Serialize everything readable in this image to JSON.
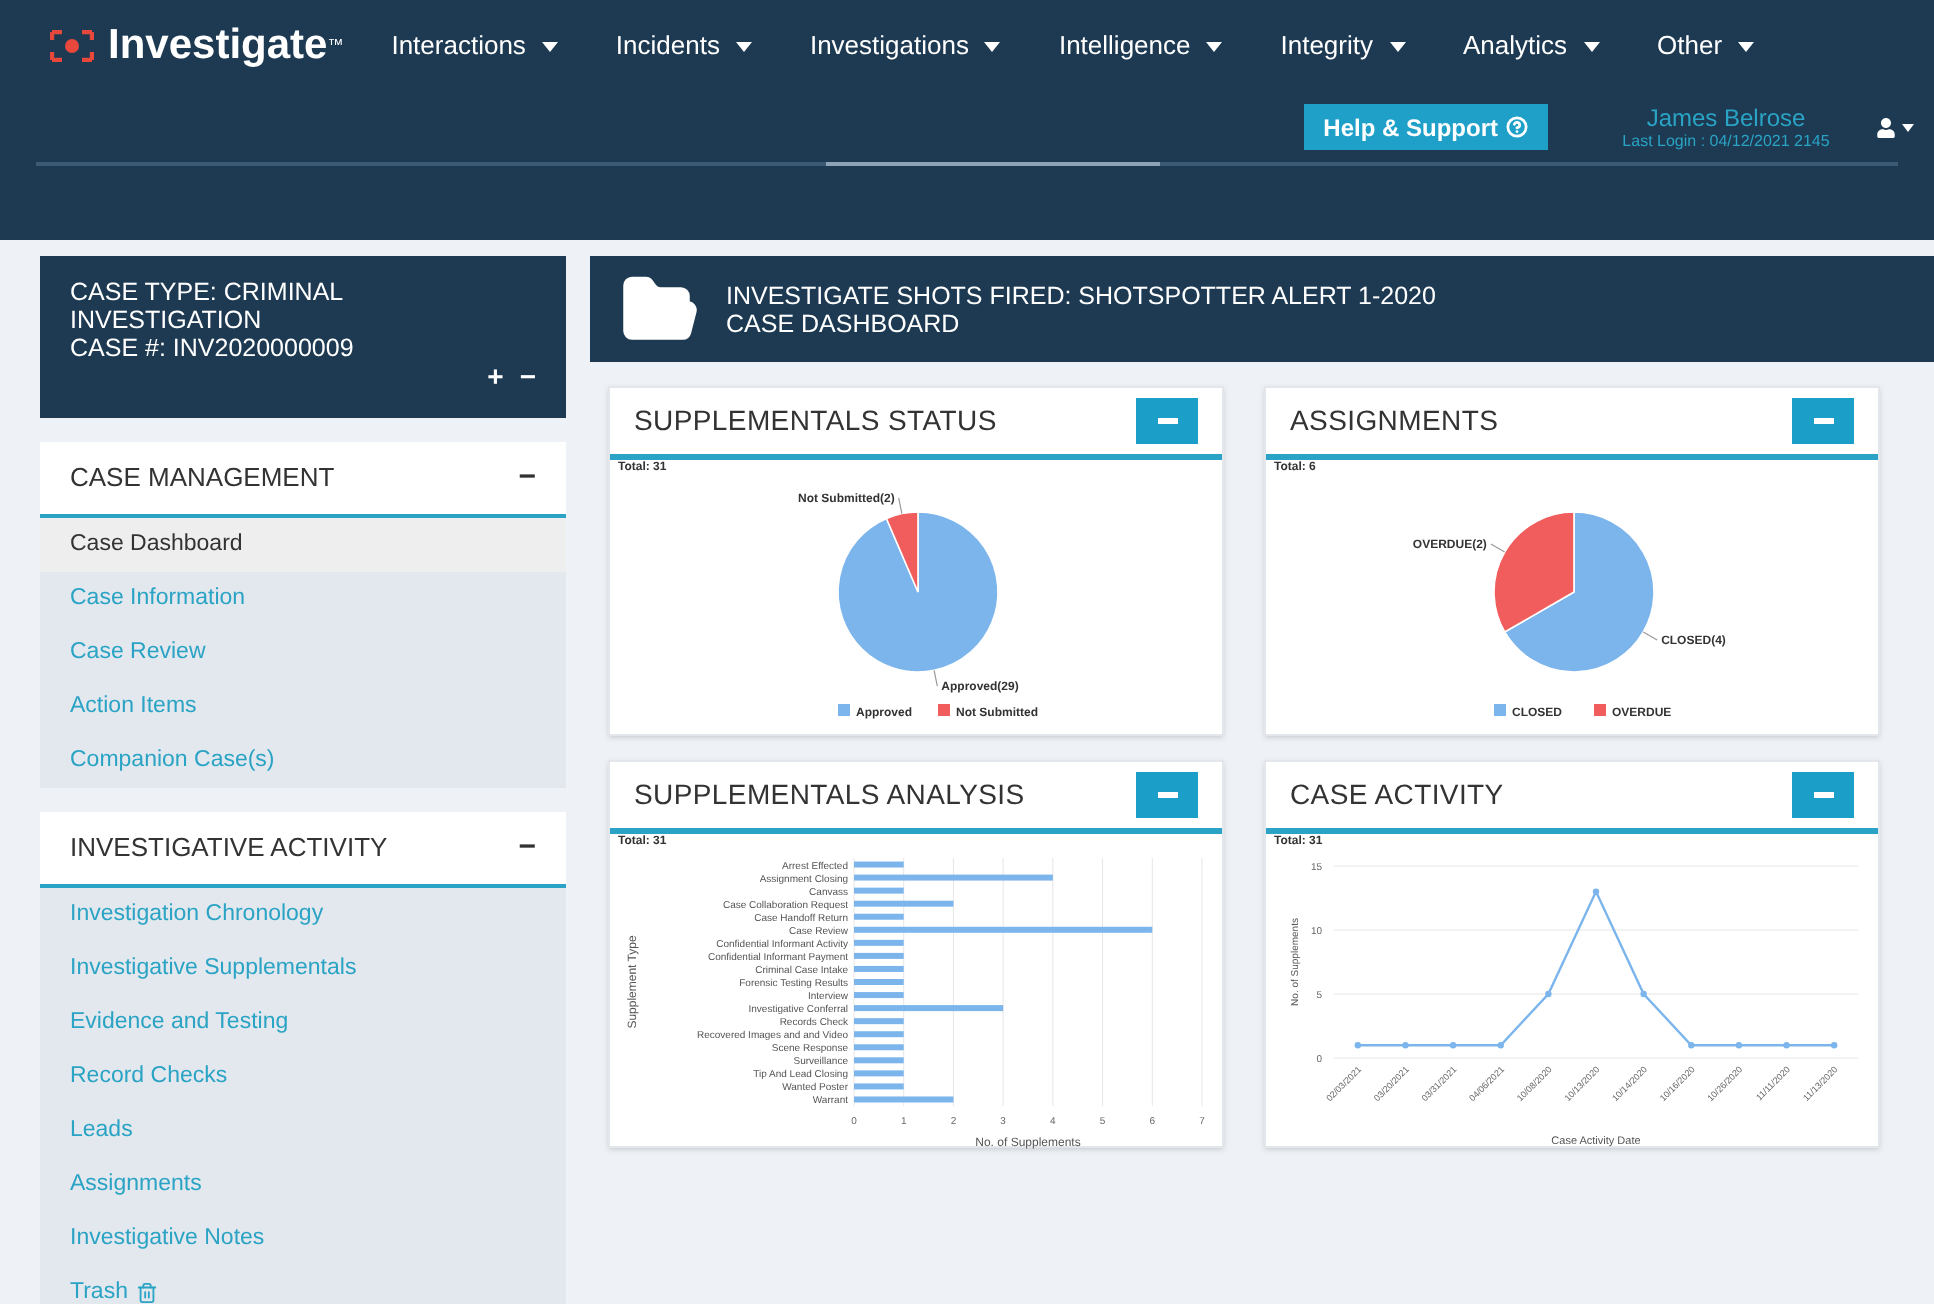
{
  "header": {
    "logo": "Investigate",
    "trademark": "™",
    "nav": [
      {
        "label": "Interactions"
      },
      {
        "label": "Incidents"
      },
      {
        "label": "Investigations"
      },
      {
        "label": "Intelligence"
      },
      {
        "label": "Integrity"
      },
      {
        "label": "Analytics"
      },
      {
        "label": "Other"
      }
    ],
    "help_button": "Help & Support",
    "user": {
      "name": "James Belrose",
      "last_login": "Last Login : 04/12/2021 2145"
    }
  },
  "case_box": {
    "case_type": "CASE TYPE: CRIMINAL INVESTIGATION",
    "case_number": "CASE #: INV2020000009",
    "expand": "+",
    "collapse": "−"
  },
  "sidebar": [
    {
      "title": "CASE MANAGEMENT",
      "toggle": "−",
      "items": [
        {
          "label": "Case Dashboard",
          "kind": "link",
          "selected": true
        },
        {
          "label": "Case Information",
          "kind": "link",
          "selected": false
        },
        {
          "label": "Case Review",
          "kind": "link",
          "selected": false
        },
        {
          "label": "Action Items",
          "kind": "link",
          "selected": false
        },
        {
          "label": "Companion Case(s)",
          "kind": "link",
          "selected": false
        }
      ]
    },
    {
      "title": "INVESTIGATIVE ACTIVITY",
      "toggle": "−",
      "items": [
        {
          "label": "Investigation Chronology",
          "kind": "link",
          "selected": false
        },
        {
          "label": "Investigative Supplementals",
          "kind": "link",
          "selected": false
        },
        {
          "label": "Evidence and Testing",
          "kind": "link",
          "selected": false
        },
        {
          "label": "Record Checks",
          "kind": "link",
          "selected": false
        },
        {
          "label": "Leads",
          "kind": "link",
          "selected": false
        },
        {
          "label": "Assignments",
          "kind": "link",
          "selected": false
        },
        {
          "label": "Investigative Notes",
          "kind": "link",
          "selected": false
        },
        {
          "label": "Trash",
          "kind": "trash",
          "selected": false
        }
      ]
    }
  ],
  "dashboard": {
    "title": "INVESTIGATE SHOTS FIRED: SHOTSPOTTER ALERT 1-2020",
    "subtitle": "CASE DASHBOARD"
  },
  "panels": [
    {
      "title": "SUPPLEMENTALS STATUS",
      "total": "Total: 31",
      "chart_data": {
        "type": "pie",
        "categories": [
          "Approved",
          "Not Submitted"
        ],
        "colors": [
          "#7cb5ec",
          "#f15c5c"
        ],
        "values": [
          29,
          2
        ],
        "value_labels": [
          "Approved(29)",
          "Not Submitted(2)"
        ],
        "legend": "bottom"
      }
    },
    {
      "title": "ASSIGNMENTS",
      "total": "Total: 6",
      "chart_data": {
        "type": "pie",
        "categories": [
          "CLOSED",
          "OVERDUE"
        ],
        "colors": [
          "#7cb5ec",
          "#f15c5c"
        ],
        "values": [
          4,
          2
        ],
        "value_labels": [
          "CLOSED(4)",
          "OVERDUE(2)"
        ],
        "legend": "bottom"
      }
    },
    {
      "title": "SUPPLEMENTALS ANALYSIS",
      "total": "Total: 31",
      "chart_data": {
        "type": "bar",
        "orientation": "horizontal",
        "xlabel": "No. of Supplements",
        "ylabel": "Supplement Type",
        "categories": [
          "Arrest Effected",
          "Assignment Closing",
          "Canvass",
          "Case Collaboration Request",
          "Case Handoff Return",
          "Case Review",
          "Confidential Informant Activity",
          "Confidential Informant Payment",
          "Criminal Case Intake",
          "Forensic Testing Results",
          "Interview",
          "Investigative Conferral",
          "Records Check",
          "Recovered Images and and Video",
          "Scene Response",
          "Surveillance",
          "Tip And Lead Closing",
          "Wanted Poster",
          "Warrant"
        ],
        "series": [
          {
            "color": "#7cb5ec",
            "values": [
              1,
              4,
              1,
              2,
              1,
              6,
              1,
              1,
              1,
              1,
              1,
              3,
              1,
              1,
              1,
              1,
              1,
              1,
              2
            ]
          }
        ],
        "xlim": [
          0,
          7
        ],
        "xticks": [
          0,
          1,
          2,
          3,
          4,
          5,
          6,
          7
        ],
        "grid": true
      }
    },
    {
      "title": "CASE ACTIVITY",
      "total": "Total: 31",
      "chart_data": {
        "type": "line",
        "xlabel": "Case Activity Date",
        "ylabel": "No. of Supplements",
        "categories": [
          "02/03/2021",
          "03/20/2021",
          "03/31/2021",
          "04/06/2021",
          "10/08/2020",
          "10/13/2020",
          "10/14/2020",
          "10/16/2020",
          "10/26/2020",
          "11/11/2020",
          "11/13/2020"
        ],
        "series": [
          {
            "color": "#7cb5ec",
            "marker": true,
            "values": [
              1,
              1,
              1,
              1,
              5,
              13,
              5,
              1,
              1,
              1,
              1
            ]
          }
        ],
        "ylim": [
          0,
          15
        ],
        "yticks": [
          0,
          5,
          10,
          15
        ],
        "grid": true
      }
    }
  ]
}
